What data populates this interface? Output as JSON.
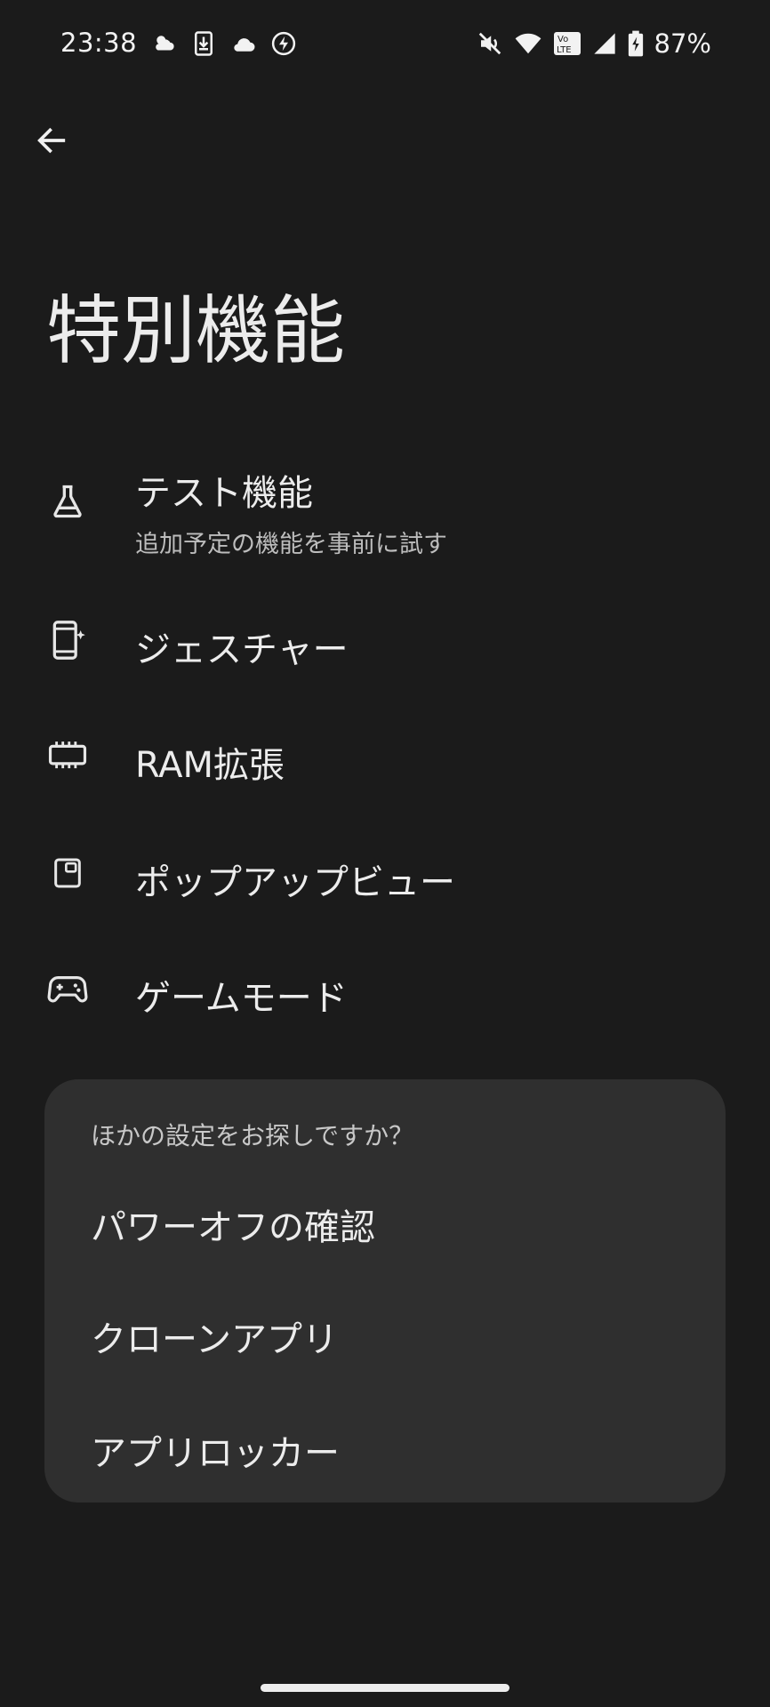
{
  "status_bar": {
    "time": "23:38",
    "battery_percent": "87%",
    "left_icons": [
      "weather-icon",
      "download-icon",
      "cloud-icon",
      "bolt-icon"
    ],
    "right_icons": [
      "mute-icon",
      "wifi-icon",
      "volte-icon",
      "signal-icon",
      "battery-charging-icon"
    ],
    "volte_label_top": "Vo",
    "volte_label_bottom": "LTE"
  },
  "header": {
    "title": "特別機能"
  },
  "menu": {
    "items": [
      {
        "icon": "flask-icon",
        "title": "テスト機能",
        "subtitle": "追加予定の機能を事前に試す"
      },
      {
        "icon": "phone-sparkle-icon",
        "title": "ジェスチャー"
      },
      {
        "icon": "ram-chip-icon",
        "title": "RAM拡張"
      },
      {
        "icon": "popup-view-icon",
        "title": "ポップアップビュー"
      },
      {
        "icon": "gamepad-icon",
        "title": "ゲームモード"
      }
    ]
  },
  "other_settings": {
    "heading": "ほかの設定をお探しですか？",
    "links": [
      {
        "label": "パワーオフの確認"
      },
      {
        "label": "クローンアプリ"
      },
      {
        "label": "アプリロッカー"
      }
    ]
  },
  "colors": {
    "background": "#1b1b1b",
    "card": "#2f2f2f",
    "text_primary": "#ececec",
    "text_secondary": "#bdbdbd"
  }
}
